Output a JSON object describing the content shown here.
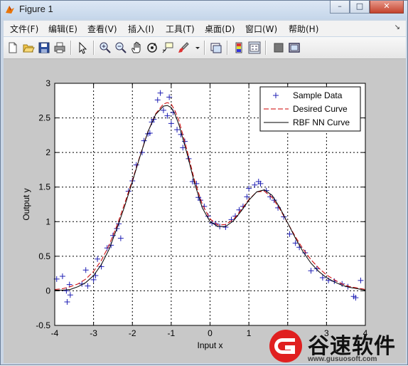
{
  "window": {
    "title": "Figure 1",
    "controls": {
      "minimize": "–",
      "maximize": "□",
      "close": "✕"
    }
  },
  "menubar": {
    "items": [
      "文件(F)",
      "编辑(E)",
      "查看(V)",
      "插入(I)",
      "工具(T)",
      "桌面(D)",
      "窗口(W)",
      "帮助(H)"
    ],
    "overflow_arrow": "↘"
  },
  "toolbar": {
    "icons": [
      "new-figure-icon",
      "open-file-icon",
      "save-icon",
      "print-icon",
      "edit-plot-arrow-icon",
      "zoom-in-icon",
      "zoom-out-icon",
      "pan-hand-icon",
      "rotate-3d-icon",
      "data-cursor-icon",
      "brush-icon",
      "link-plot-icon",
      "colorbar-icon",
      "legend-icon",
      "hide-plot-tools-icon",
      "show-plot-tools-icon"
    ]
  },
  "colors": {
    "sample": "#1f1fb4",
    "desired": "#cc0000",
    "rbf": "#000000",
    "figure_bg": "#c8c8c8"
  },
  "chart_data": {
    "type": "line",
    "title": "",
    "xlabel": "Input x",
    "ylabel": "Output y",
    "xlim": [
      -4,
      4
    ],
    "ylim": [
      -0.5,
      3
    ],
    "xticks": [
      -4,
      -3,
      -2,
      -1,
      0,
      1,
      2,
      3,
      4
    ],
    "yticks": [
      -0.5,
      0,
      0.5,
      1,
      1.5,
      2,
      2.5,
      3
    ],
    "grid": true,
    "legend_position": "top-right",
    "series": [
      {
        "name": "Sample Data",
        "style": "markers-plus",
        "x": [
          -3.95,
          -3.8,
          -3.7,
          -3.68,
          -3.62,
          -3.6,
          -3.3,
          -3.2,
          -3.15,
          -3.0,
          -2.95,
          -2.9,
          -2.8,
          -2.65,
          -2.55,
          -2.5,
          -2.4,
          -2.35,
          -2.3,
          -2.1,
          -2.0,
          -1.9,
          -1.75,
          -1.7,
          -1.6,
          -1.55,
          -1.5,
          -1.45,
          -1.35,
          -1.28,
          -1.2,
          -1.1,
          -1.05,
          -1.0,
          -0.95,
          -0.85,
          -0.75,
          -0.7,
          -0.65,
          -0.55,
          -0.45,
          -0.35,
          -0.3,
          -0.25,
          -0.15,
          -0.05,
          0.05,
          0.15,
          0.25,
          0.4,
          0.55,
          0.65,
          0.75,
          0.85,
          0.95,
          1.0,
          1.15,
          1.25,
          1.3,
          1.45,
          1.55,
          1.65,
          1.75,
          1.9,
          2.05,
          2.2,
          2.3,
          2.45,
          2.6,
          2.75,
          2.9,
          3.05,
          3.2,
          3.4,
          3.55,
          3.7,
          3.75,
          3.88
        ],
        "y": [
          0.17,
          0.21,
          0.0,
          -0.16,
          0.09,
          -0.06,
          0.1,
          0.3,
          0.07,
          0.16,
          0.22,
          0.46,
          0.35,
          0.62,
          0.66,
          0.8,
          0.9,
          0.97,
          0.76,
          1.44,
          1.59,
          1.82,
          2.0,
          2.17,
          2.27,
          2.28,
          2.44,
          2.48,
          2.76,
          2.86,
          2.61,
          2.53,
          2.8,
          2.42,
          2.58,
          2.33,
          2.26,
          2.07,
          2.16,
          1.91,
          1.58,
          1.55,
          1.35,
          1.31,
          1.22,
          1.08,
          0.98,
          0.97,
          0.93,
          0.92,
          1.03,
          1.08,
          1.17,
          1.22,
          1.36,
          1.48,
          1.53,
          1.58,
          1.55,
          1.45,
          1.36,
          1.31,
          1.2,
          1.07,
          0.82,
          0.69,
          0.63,
          0.55,
          0.29,
          0.32,
          0.19,
          0.15,
          0.14,
          0.1,
          0.06,
          -0.08,
          -0.1,
          0.15
        ]
      },
      {
        "name": "Desired Curve",
        "style": "dashed",
        "x": [
          -4.0,
          -3.8,
          -3.6,
          -3.4,
          -3.2,
          -3.0,
          -2.8,
          -2.6,
          -2.4,
          -2.2,
          -2.0,
          -1.8,
          -1.6,
          -1.4,
          -1.2,
          -1.1,
          -1.0,
          -0.9,
          -0.8,
          -0.6,
          -0.4,
          -0.2,
          0.0,
          0.2,
          0.4,
          0.6,
          0.8,
          1.0,
          1.2,
          1.4,
          1.6,
          1.8,
          2.0,
          2.2,
          2.4,
          2.6,
          2.8,
          3.0,
          3.2,
          3.4,
          3.6,
          3.8,
          4.0
        ],
        "y": [
          0.02,
          0.03,
          0.06,
          0.1,
          0.17,
          0.28,
          0.44,
          0.66,
          0.94,
          1.26,
          1.6,
          1.96,
          2.3,
          2.56,
          2.7,
          2.72,
          2.7,
          2.6,
          2.46,
          2.05,
          1.6,
          1.25,
          1.04,
          0.95,
          0.96,
          1.03,
          1.17,
          1.32,
          1.43,
          1.44,
          1.35,
          1.18,
          0.98,
          0.78,
          0.6,
          0.45,
          0.33,
          0.23,
          0.16,
          0.1,
          0.06,
          0.04,
          0.02
        ]
      },
      {
        "name": "RBF NN Curve",
        "style": "solid",
        "x": [
          -4.0,
          -3.8,
          -3.6,
          -3.4,
          -3.2,
          -3.0,
          -2.8,
          -2.6,
          -2.4,
          -2.2,
          -2.0,
          -1.8,
          -1.6,
          -1.4,
          -1.2,
          -1.1,
          -1.0,
          -0.9,
          -0.8,
          -0.6,
          -0.4,
          -0.2,
          0.0,
          0.2,
          0.4,
          0.6,
          0.8,
          1.0,
          1.2,
          1.4,
          1.6,
          1.8,
          2.0,
          2.2,
          2.4,
          2.6,
          2.8,
          3.0,
          3.2,
          3.4,
          3.6,
          3.8,
          4.0
        ],
        "y": [
          0.01,
          0.01,
          0.02,
          0.06,
          0.12,
          0.22,
          0.38,
          0.6,
          0.9,
          1.22,
          1.58,
          1.95,
          2.3,
          2.55,
          2.67,
          2.68,
          2.65,
          2.55,
          2.4,
          2.0,
          1.56,
          1.2,
          1.0,
          0.93,
          0.93,
          1.01,
          1.15,
          1.31,
          1.43,
          1.46,
          1.38,
          1.2,
          0.98,
          0.76,
          0.56,
          0.4,
          0.28,
          0.19,
          0.13,
          0.08,
          0.05,
          0.03,
          0.01
        ]
      }
    ]
  },
  "watermark": {
    "cn_text": "谷速软件",
    "url": "www.gusuosoft.com"
  }
}
